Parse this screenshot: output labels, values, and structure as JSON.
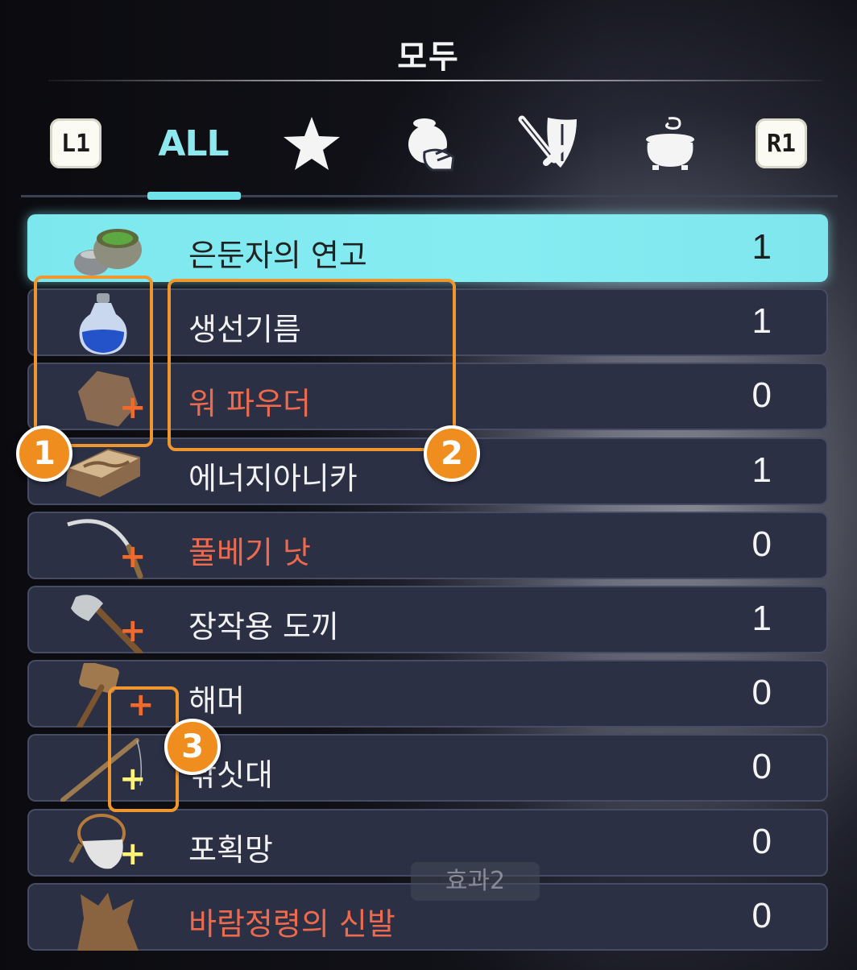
{
  "header": {
    "title": "모두"
  },
  "tabs": {
    "left_button": "L1",
    "right_button": "R1",
    "items": [
      {
        "label": "ALL",
        "icon": "all-text",
        "active": true
      },
      {
        "icon": "star-icon"
      },
      {
        "icon": "money-bag-hand-icon"
      },
      {
        "icon": "sword-shield-icon"
      },
      {
        "icon": "cauldron-icon"
      }
    ]
  },
  "items": [
    {
      "name": "은둔자의 연고",
      "count": "1",
      "selected": true,
      "missing": false,
      "icon": "ointment-pot-icon"
    },
    {
      "name": "생선기름",
      "count": "1",
      "missing": false,
      "icon": "blue-potion-bottle-icon"
    },
    {
      "name": "워 파우더",
      "count": "0",
      "missing": true,
      "icon": "powder-hexagon-icon",
      "plus": "orange"
    },
    {
      "name": "에너지아니카",
      "count": "1",
      "missing": false,
      "icon": "energy-box-icon"
    },
    {
      "name": "풀베기 낫",
      "count": "0",
      "missing": true,
      "icon": "sickle-icon",
      "plus": "orange"
    },
    {
      "name": "장작용 도끼",
      "count": "1",
      "missing": false,
      "icon": "axe-icon",
      "plus": "orange"
    },
    {
      "name": "해머",
      "count": "0",
      "missing": false,
      "icon": "hammer-icon",
      "plus": "orange"
    },
    {
      "name": "낚싯대",
      "count": "0",
      "missing": false,
      "icon": "fishing-rod-icon",
      "plus": "yellow"
    },
    {
      "name": "포획망",
      "count": "0",
      "missing": false,
      "icon": "catch-net-icon",
      "plus": "yellow"
    },
    {
      "name": "바람정령의 신발",
      "count": "0",
      "missing": true,
      "icon": "wind-boots-icon"
    }
  ],
  "annotations": [
    "1",
    "2",
    "3"
  ],
  "tooltip_ghost": "효과2",
  "colors": {
    "accent": "#6fe2ea",
    "missing": "#ee6a4e",
    "annotation": "#f0962f"
  }
}
